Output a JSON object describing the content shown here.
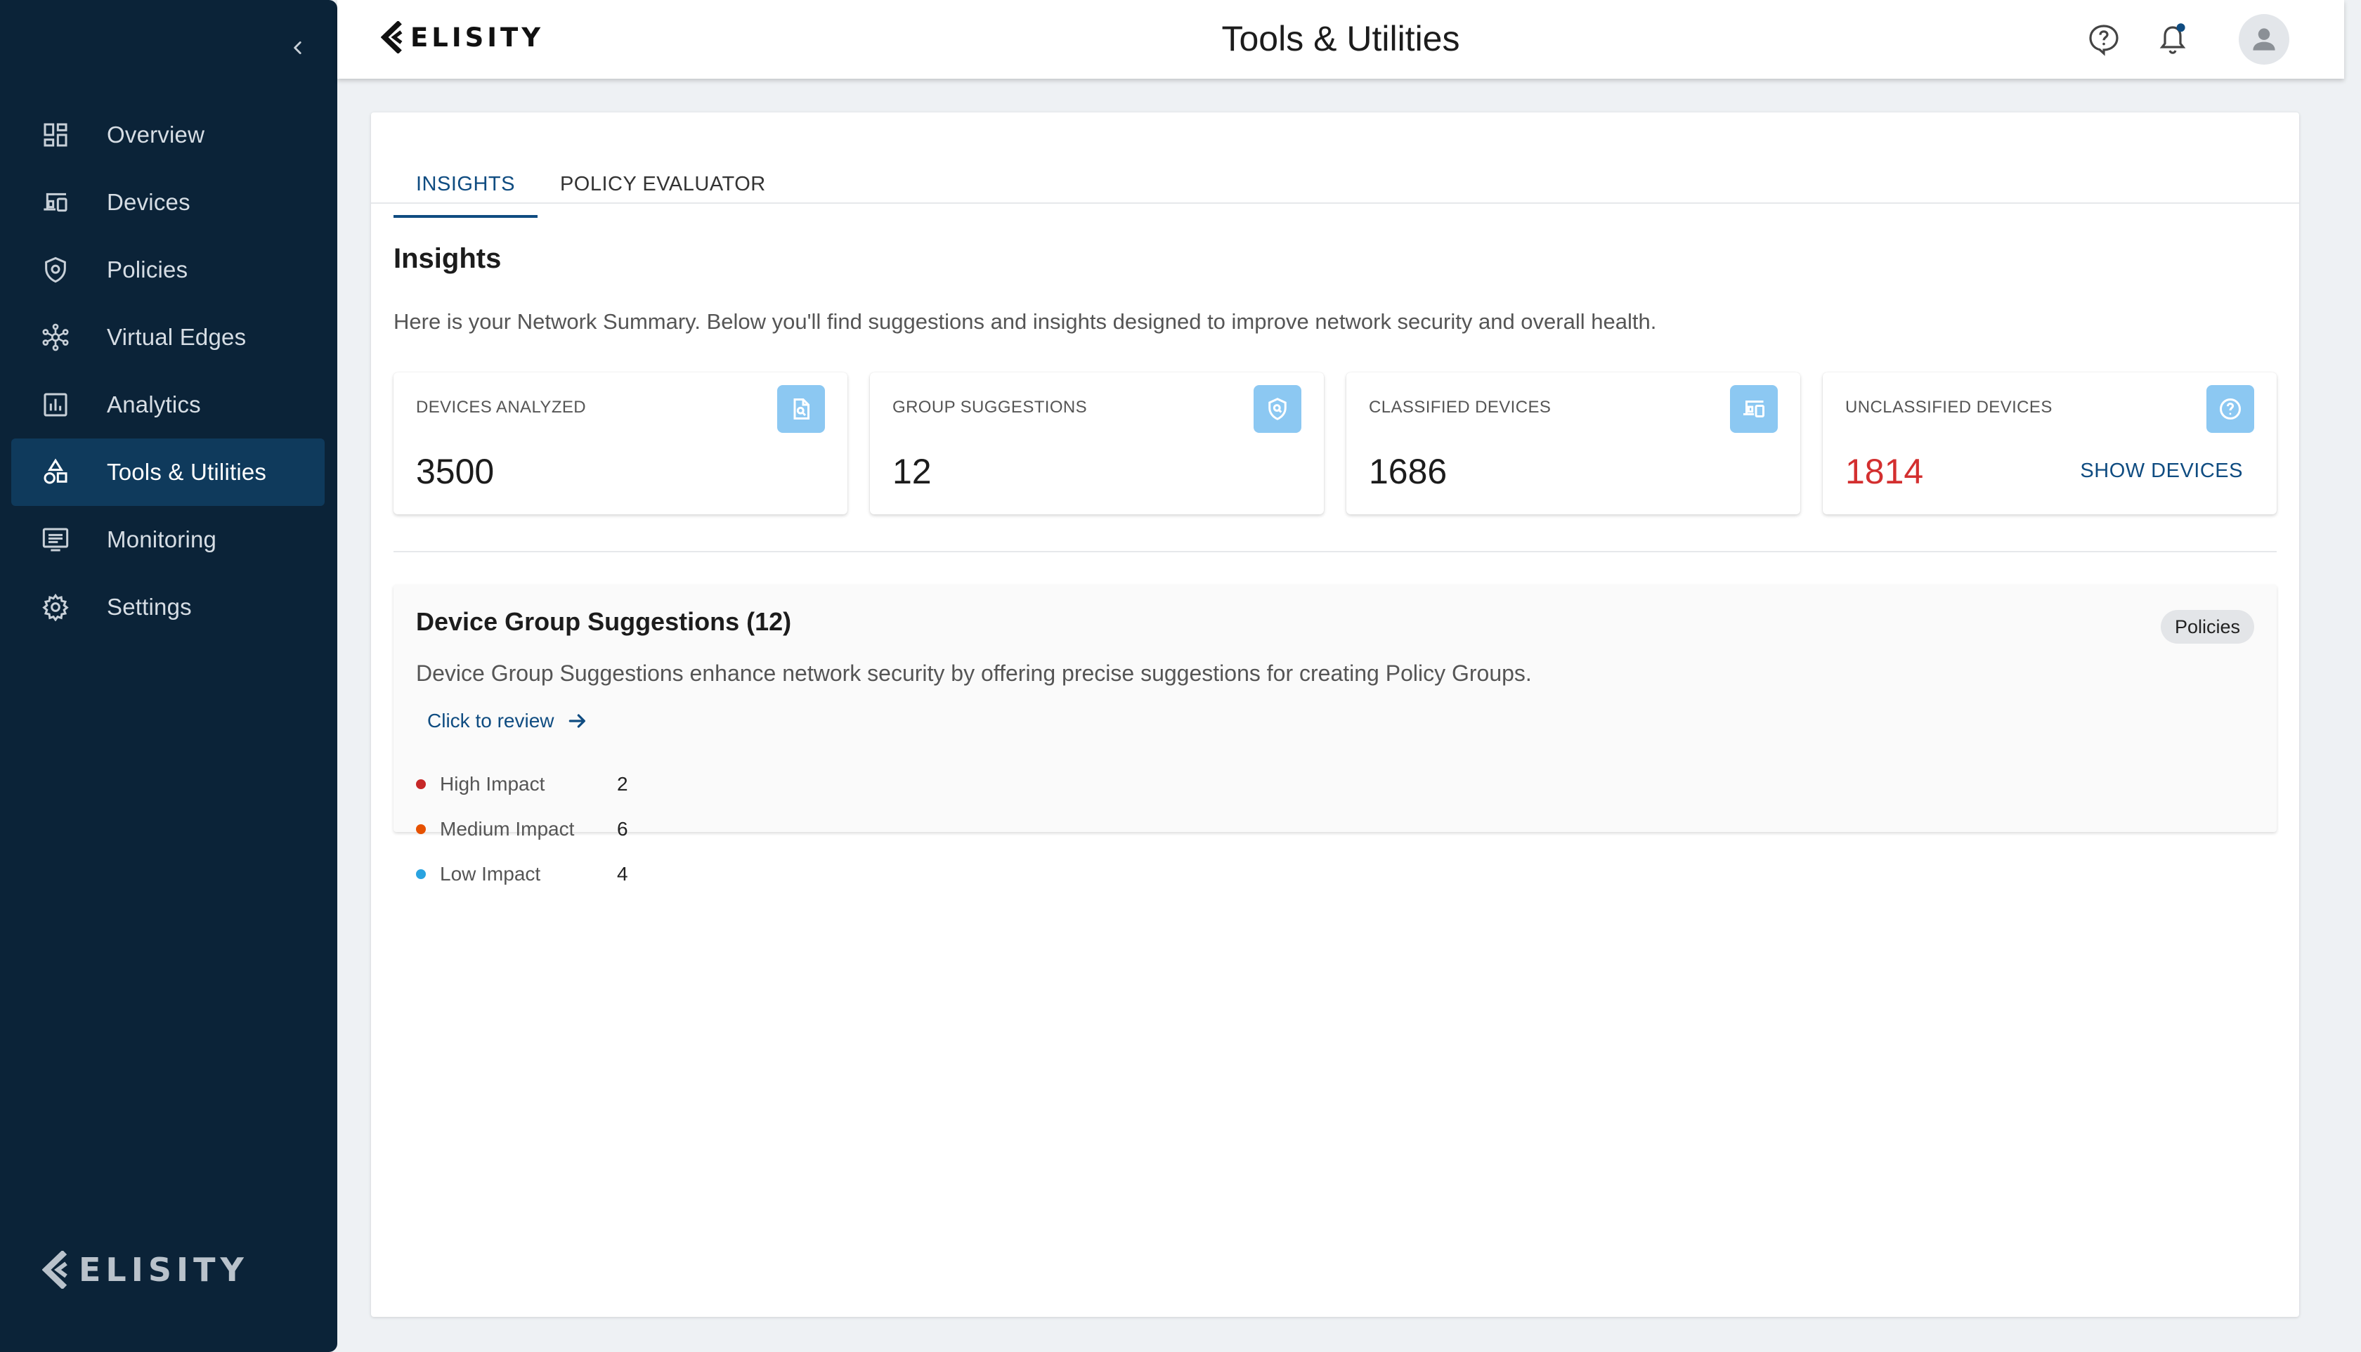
{
  "brand": {
    "name": "ELISITY"
  },
  "header": {
    "title": "Tools & Utilities"
  },
  "sidebar": {
    "items": [
      {
        "label": "Overview",
        "icon": "dashboard-icon",
        "active": false
      },
      {
        "label": "Devices",
        "icon": "devices-icon",
        "active": false
      },
      {
        "label": "Policies",
        "icon": "shield-icon",
        "active": false
      },
      {
        "label": "Virtual Edges",
        "icon": "network-hub-icon",
        "active": false
      },
      {
        "label": "Analytics",
        "icon": "bar-chart-icon",
        "active": false
      },
      {
        "label": "Tools & Utilities",
        "icon": "shapes-icon",
        "active": true
      },
      {
        "label": "Monitoring",
        "icon": "monitor-icon",
        "active": false
      },
      {
        "label": "Settings",
        "icon": "gear-icon",
        "active": false
      }
    ]
  },
  "tabs": [
    {
      "label": "INSIGHTS",
      "active": true
    },
    {
      "label": "POLICY EVALUATOR",
      "active": false
    }
  ],
  "insights": {
    "title": "Insights",
    "description": "Here is your Network Summary. Below you'll find suggestions and insights designed to improve network security and overall health.",
    "stats": [
      {
        "label": "DEVICES ANALYZED",
        "value": "3500",
        "icon": "document-search-icon"
      },
      {
        "label": "GROUP SUGGESTIONS",
        "value": "12",
        "icon": "shield-search-icon"
      },
      {
        "label": "CLASSIFIED DEVICES",
        "value": "1686",
        "icon": "devices-icon"
      },
      {
        "label": "UNCLASSIFIED DEVICES",
        "value": "1814",
        "icon": "help-icon",
        "action": "SHOW DEVICES"
      }
    ]
  },
  "suggestions": {
    "title": "Device Group Suggestions (12)",
    "chip": "Policies",
    "description": "Device Group Suggestions enhance network security by offering precise suggestions for creating Policy Groups.",
    "review_link": "Click to review",
    "impacts": [
      {
        "name": "High Impact",
        "value": "2",
        "color": "#c62828"
      },
      {
        "name": "Medium Impact",
        "value": "6",
        "color": "#e65100"
      },
      {
        "name": "Low Impact",
        "value": "4",
        "color": "#29a3e0"
      }
    ]
  },
  "colors": {
    "sidebar_bg": "#0b2338",
    "sidebar_active": "#0f3a5c",
    "accent": "#0f4c81",
    "stat_icon_bg": "#8cc8f2",
    "danger": "#d32f2f"
  }
}
